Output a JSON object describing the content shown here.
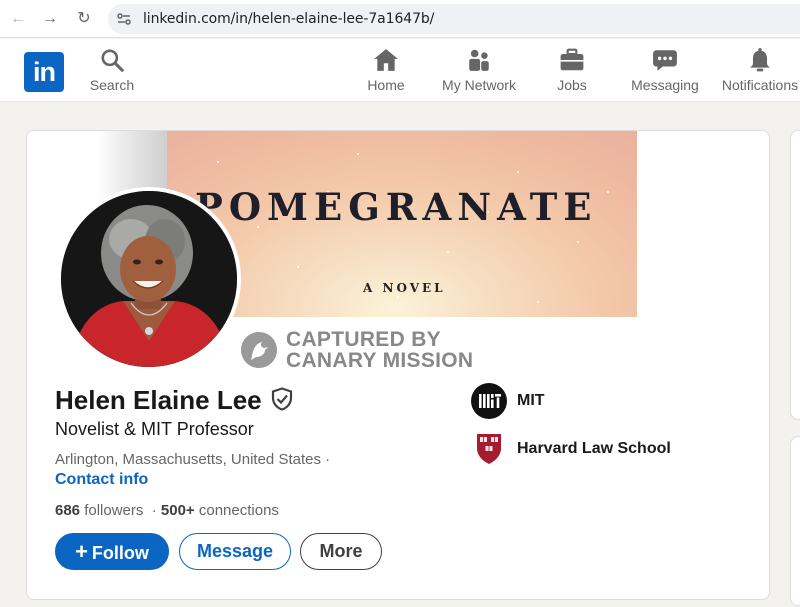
{
  "browser": {
    "url": "linkedin.com/in/helen-elaine-lee-7a1647b/"
  },
  "header": {
    "logo_text": "in",
    "nav": [
      {
        "label": "Search",
        "icon": "search-icon"
      },
      {
        "label": "Home",
        "icon": "home-icon"
      },
      {
        "label": "My Network",
        "icon": "network-icon"
      },
      {
        "label": "Jobs",
        "icon": "briefcase-icon"
      },
      {
        "label": "Messaging",
        "icon": "chat-icon"
      },
      {
        "label": "Notifications",
        "icon": "bell-icon"
      }
    ]
  },
  "banner": {
    "title": "POMEGRANATE",
    "subtitle": "A NOVEL"
  },
  "watermark": {
    "line1": "CAPTURED BY",
    "line2": "CANARY MISSION"
  },
  "profile": {
    "name": "Helen Elaine Lee",
    "headline": "Novelist & MIT Professor",
    "location": "Arlington, Massachusetts, United States ·",
    "contact_link": "Contact info",
    "followers": "686",
    "followers_label": "followers",
    "connections": "500+",
    "connections_label": "connections",
    "organizations": [
      {
        "name": "MIT",
        "icon": "mit-logo"
      },
      {
        "name": "Harvard Law School",
        "icon": "harvard-shield-logo"
      }
    ]
  },
  "actions": {
    "follow": "Follow",
    "message": "Message",
    "more": "More"
  },
  "colors": {
    "brand": "#0a66c2",
    "page_bg": "#f3f2ef",
    "harvard_crimson": "#a51c30"
  }
}
